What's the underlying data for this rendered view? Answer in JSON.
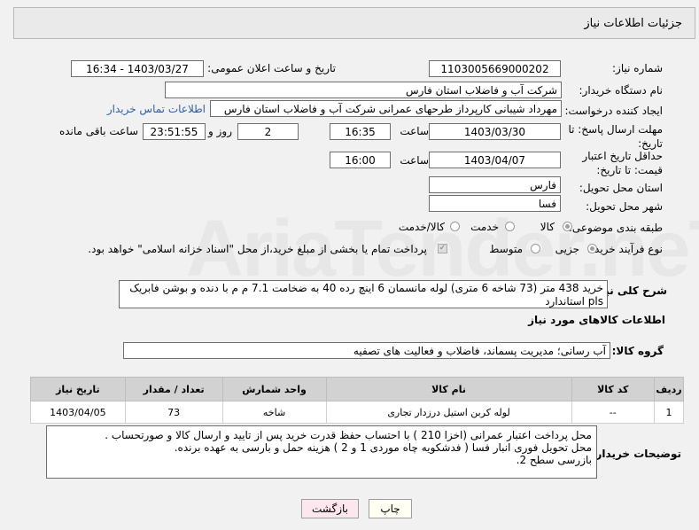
{
  "page_title": "جزئیات اطلاعات نیاز",
  "fields": {
    "need_number_label": "شماره نیاز:",
    "need_number": "1103005669000202",
    "announce_label": "تاریخ و ساعت اعلان عمومی:",
    "announce_value": "1403/03/27 - 16:34",
    "buyer_org_label": "نام دستگاه خریدار:",
    "buyer_org": "شرکت آب و فاضلاب استان فارس",
    "creator_label": "ایجاد کننده درخواست:",
    "creator": "مهرداد شیبانی کارپرداز طرحهای عمرانی  شرکت آب و فاضلاب استان فارس",
    "contact_link": "اطلاعات تماس خریدار",
    "deadline_label": "مهلت ارسال پاسخ: تا تاریخ:",
    "deadline_date": "1403/03/30",
    "time_label": "ساعت",
    "deadline_time": "16:35",
    "days_value": "2",
    "days_label": "روز و",
    "remaining_time": "23:51:55",
    "remaining_label": "ساعت باقی مانده",
    "validity_label": "حداقل تاریخ اعتبار قیمت: تا تاریخ:",
    "validity_date": "1403/04/07",
    "validity_time": "16:00",
    "province_label": "استان محل تحویل:",
    "province": "فارس",
    "city_label": "شهر محل تحویل:",
    "city": "فسا",
    "category_label": "طبقه بندی موضوعی:",
    "category_options": [
      "کالا",
      "خدمت",
      "کالا/خدمت"
    ],
    "process_label": "نوع فرآیند خرید :",
    "process_options": [
      "جزیی",
      "متوسط"
    ],
    "process_note": "پرداخت تمام یا بخشی از مبلغ خرید،از محل \"اسناد خزانه اسلامی\" خواهد بود."
  },
  "description": {
    "label": "شرح کلی نیاز:",
    "text": "خرید 438 متر (73 شاخه 6 متری) لوله مانسمان 6 اینچ رده 40 به ضخامت 7.1 م م با دنده و بوشن فابریک pls استاندارد"
  },
  "goods_section_title": "اطلاعات کالاهای مورد نیاز",
  "goods_group": {
    "label": "گروه کالا:",
    "value": "آب رسانی؛ مدیریت پسماند، فاضلاب و فعالیت های تصفیه"
  },
  "table": {
    "headers": [
      "ردیف",
      "کد کالا",
      "نام کالا",
      "واحد شمارش",
      "تعداد / مقدار",
      "تاریخ نیاز"
    ],
    "rows": [
      [
        "1",
        "--",
        "لوله کربن استیل درزدار تجاری",
        "شاخه",
        "73",
        "1403/04/05"
      ]
    ]
  },
  "buyer_notes": {
    "label": "توضیحات خریدار:",
    "lines": [
      "محل پرداخت اعتبار عمرانی (اخزا 210 ) با احتساب حفظ قدرت خرید پس از تایید و ارسال کالا و صورتحساب .",
      "محل تحویل فوری انبار فسا ( فدشکویه چاه موردی 1 و 2 ) هزینه حمل و بارسی به عهده برنده.",
      "بازرسی سطح 2."
    ]
  },
  "buttons": {
    "print": "چاپ",
    "back": "بازگشت"
  },
  "watermark": "AriaTender.neT"
}
